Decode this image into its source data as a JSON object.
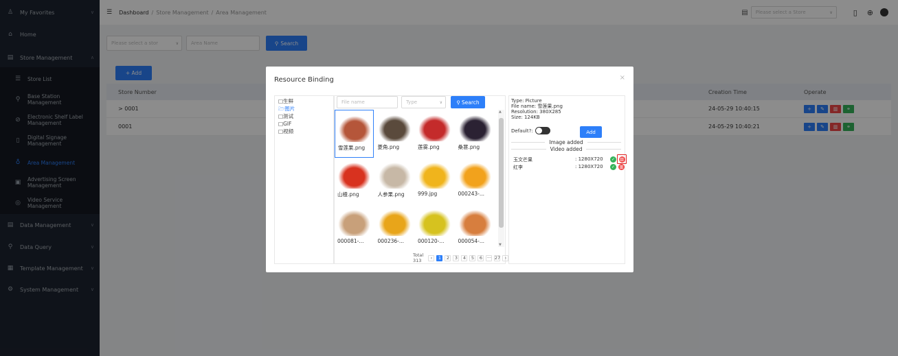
{
  "sidebar": {
    "favorites": "My Favorites",
    "home": "Home",
    "store_management": "Store Management",
    "items": [
      {
        "label": "Store List",
        "icon": "list-icon"
      },
      {
        "label": "Base Station Management",
        "icon": "antenna-icon"
      },
      {
        "label": "Electronic Shelf Label Management",
        "icon": "tag-icon"
      },
      {
        "label": "Digital Signage Management",
        "icon": "tablet-icon"
      },
      {
        "label": "Area Management",
        "icon": "area-icon"
      },
      {
        "label": "Advertising Screen Management",
        "icon": "ad-icon"
      },
      {
        "label": "Video Service Management",
        "icon": "video-icon"
      }
    ],
    "sections": [
      "Data Management",
      "Data Query",
      "Template Management",
      "System Management"
    ]
  },
  "header": {
    "breadcrumb": [
      "Dashboard",
      "Store Management",
      "Area Management"
    ],
    "store_select_placeholder": "Please select a Store"
  },
  "filters": {
    "store_placeholder": "Please select a stor",
    "area_placeholder": "Area Name",
    "search_label": "Search",
    "add_label": "+ Add"
  },
  "table": {
    "columns": [
      "Store Number",
      "Creation Time",
      "Operate"
    ],
    "rows": [
      {
        "store": "> 0001",
        "time": "24-05-29 10:40:15"
      },
      {
        "store": "0001",
        "time": "24-05-29 10:40:21"
      }
    ]
  },
  "modal": {
    "title": "Resource Binding",
    "close": "×",
    "categories": [
      "□生鲜",
      "🗁图片",
      "□测试",
      "□GIF",
      "□视频"
    ],
    "filename_placeholder": "File name",
    "type_placeholder": "Type",
    "search_label": "Search",
    "files": [
      {
        "name": "雪莲果.png",
        "color": "#b5563a"
      },
      {
        "name": "菱角.png",
        "color": "#5a4a3c"
      },
      {
        "name": "莲雾.png",
        "color": "#c42b2b"
      },
      {
        "name": "桑葚.png",
        "color": "#2b2233"
      },
      {
        "name": "山楂.png",
        "color": "#d8321f"
      },
      {
        "name": "人参果.png",
        "color": "#c7b8a6"
      },
      {
        "name": "999.jpg",
        "color": "#f0b41c"
      },
      {
        "name": "000243-...",
        "color": "#f2a21c"
      },
      {
        "name": "000081-...",
        "color": "#c8a07a"
      },
      {
        "name": "000236-...",
        "color": "#e8a51a"
      },
      {
        "name": "000120-...",
        "color": "#d6c21f"
      },
      {
        "name": "000054-...",
        "color": "#d77e3e"
      }
    ],
    "pager": {
      "total": "Total 313",
      "pages": [
        "1",
        "2",
        "3",
        "4",
        "5",
        "6",
        "···",
        "27"
      ],
      "current": "1"
    },
    "info": {
      "type": "Type: Picture",
      "filename": "File name: 雪莲果.png",
      "resolution": "Resolution: 380X285",
      "size": "Size: 124KB",
      "default_label": "Default?:",
      "add_label": "Add",
      "image_added": "Image added",
      "video_added": "Video added"
    },
    "bound": [
      {
        "name": "玉文芒果",
        "res": ": 1280X720"
      },
      {
        "name": "红李",
        "res": ": 1280X720"
      }
    ]
  }
}
